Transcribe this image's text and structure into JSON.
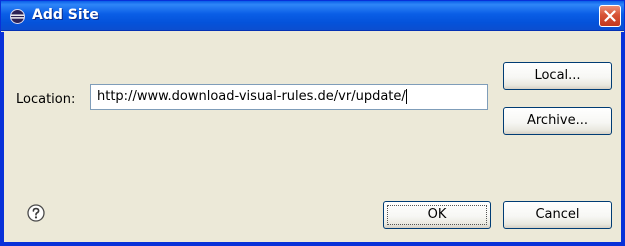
{
  "window": {
    "title": "Add Site"
  },
  "form": {
    "location_label": "Location:",
    "location_value": "http://www.download-visual-rules.de/vr/update/"
  },
  "buttons": {
    "local": "Local...",
    "archive": "Archive...",
    "ok": "OK",
    "cancel": "Cancel"
  },
  "icons": {
    "title_icon": "eclipse-icon",
    "close": "close-icon",
    "help": "help-icon"
  },
  "colors": {
    "titlebar": "#0a5ee6",
    "close": "#d75335",
    "dialog_bg": "#ece9d8"
  }
}
